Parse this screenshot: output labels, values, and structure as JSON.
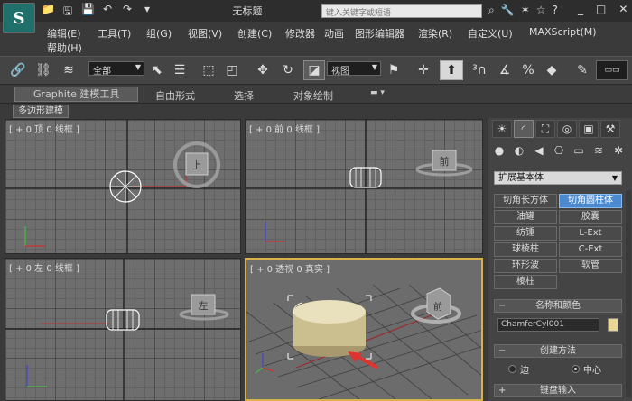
{
  "titlebar": {
    "logo": "S",
    "title": "无标题",
    "search_placeholder": "键入关键字或短语",
    "quick_access": [
      "📁",
      "🖫",
      "💾",
      "↶",
      "↷",
      "▾"
    ],
    "tool_icons": [
      "⌕",
      "🔧",
      "✶",
      "☆",
      "?",
      "▾"
    ],
    "window_controls": [
      "_",
      "□",
      "✕"
    ]
  },
  "menu": {
    "items": [
      "编辑(E)",
      "工具(T)",
      "组(G)",
      "视图(V)",
      "创建(C)",
      "修改器",
      "动画",
      "图形编辑器",
      "渲染(R)",
      "自定义(U)",
      "MAXScript(M)",
      "帮助(H)"
    ]
  },
  "toolbar": {
    "selection_filter": "全部",
    "ref_coord": "视图"
  },
  "ribbon": {
    "tabs": [
      "Graphite 建模工具",
      "自由形式",
      "选择",
      "对象绘制"
    ],
    "subtab": "多边形建模"
  },
  "viewports": {
    "top": "[ + 0 顶 0 线框 ]",
    "front": "[ + 0 前 0 线框 ]",
    "left": "[ + 0 左 0 线框 ]",
    "perspective": "[ + 0 透视 0 真实 ]",
    "cube_top": "上",
    "cube_front": "前",
    "cube_left": "左",
    "cube_persp": "前"
  },
  "panel": {
    "category": "扩展基本体",
    "buttons": [
      "切角长方体",
      "切角圆柱体",
      "油罐",
      "胶囊",
      "纺锤",
      "L-Ext",
      "球棱柱",
      "C-Ext",
      "环形波",
      "软管",
      "棱柱"
    ],
    "selected_button": "切角圆柱体",
    "rollout_name": "名称和颜色",
    "object_name": "ChamferCyl001",
    "color": "#e8d796",
    "rollout_create": "创建方法",
    "radio_edge": "边",
    "radio_center": "中心",
    "rollout_keyboard": "键盘输入"
  }
}
